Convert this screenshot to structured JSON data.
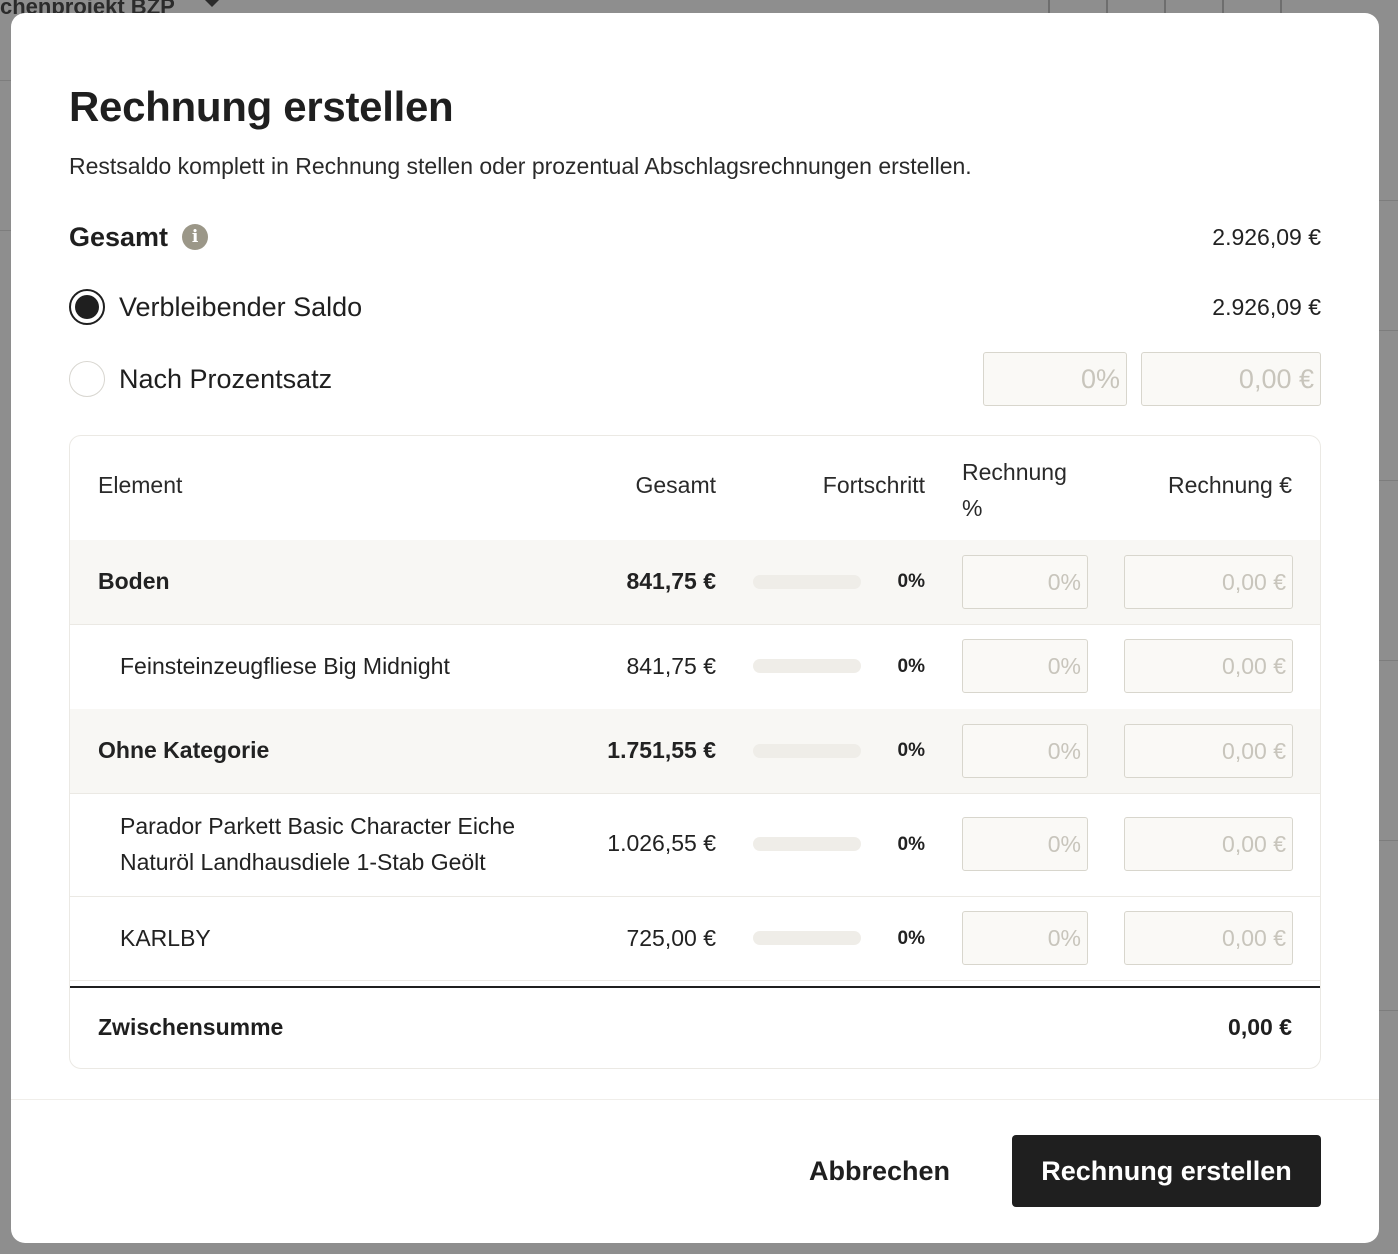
{
  "background": {
    "project_label": "chenprojekt BZP"
  },
  "modal": {
    "title": "Rechnung erstellen",
    "subtitle": "Restsaldo komplett in Rechnung stellen oder prozentual Abschlagsrechnungen erstellen.",
    "total_label": "Gesamt",
    "total_value": "2.926,09 €",
    "option_remaining_label": "Verbleibender Saldo",
    "option_remaining_value": "2.926,09 €",
    "option_percent_label": "Nach Prozentsatz",
    "percent_input_placeholder": "0%",
    "amount_input_placeholder": "0,00 €",
    "selected_option": "Verbleibender Saldo"
  },
  "table": {
    "headers": {
      "element": "Element",
      "total": "Gesamt",
      "progress": "Fortschritt",
      "invoice_pct": "Rechnung %",
      "invoice_eur": "Rechnung €"
    },
    "rows": [
      {
        "name": "Boden",
        "total": "841,75 €",
        "progress": 0,
        "progress_label": "0%",
        "pct_placeholder": "0%",
        "eur_placeholder": "0,00 €",
        "category": true
      },
      {
        "name": "Feinsteinzeugfliese Big Midnight",
        "total": "841,75 €",
        "progress": 0,
        "progress_label": "0%",
        "pct_placeholder": "0%",
        "eur_placeholder": "0,00 €",
        "category": false
      },
      {
        "name": "Ohne Kategorie",
        "total": "1.751,55 €",
        "progress": 0,
        "progress_label": "0%",
        "pct_placeholder": "0%",
        "eur_placeholder": "0,00 €",
        "category": true
      },
      {
        "name": "Parador Parkett Basic Character Eiche Naturöl Landhausdiele 1-Stab Geölt",
        "total": "1.026,55 €",
        "progress": 0,
        "progress_label": "0%",
        "pct_placeholder": "0%",
        "eur_placeholder": "0,00 €",
        "category": false
      },
      {
        "name": "KARLBY",
        "total": "725,00 €",
        "progress": 0,
        "progress_label": "0%",
        "pct_placeholder": "0%",
        "eur_placeholder": "0,00 €",
        "category": false
      }
    ],
    "subtotal_label": "Zwischensumme",
    "subtotal_value": "0,00 €"
  },
  "footer": {
    "cancel_label": "Abbrechen",
    "submit_label": "Rechnung erstellen"
  },
  "colors": {
    "primary_button": "#1f1f1f",
    "overlay": "#8e8e8e",
    "info_icon": "#9b9788",
    "category_row": "#f8f7f4"
  }
}
